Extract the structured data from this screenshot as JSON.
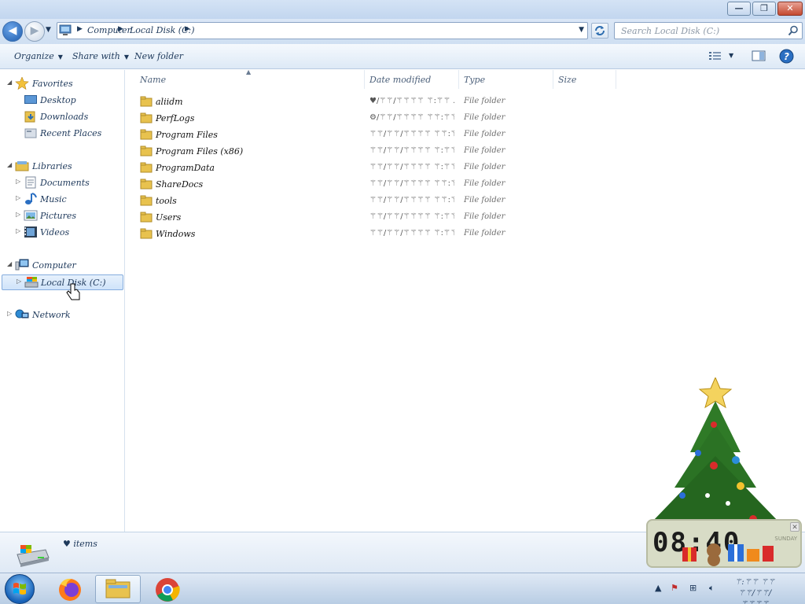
{
  "window": {
    "min_glyph": "—",
    "max_glyph": "❐",
    "close_glyph": "✕"
  },
  "address_bar": {
    "breadcrumbs": [
      "Computer",
      "Local Disk (C:)"
    ],
    "search_placeholder": "Search Local Disk (C:)"
  },
  "toolbar": {
    "organize_label": "Organize",
    "share_label": "Share with",
    "new_folder_label": "New folder"
  },
  "navigation": {
    "favorites_label": "Favorites",
    "favorites": [
      "Desktop",
      "Downloads",
      "Recent Places"
    ],
    "libraries_label": "Libraries",
    "libraries": [
      "Documents",
      "Music",
      "Pictures",
      "Videos"
    ],
    "computer_label": "Computer",
    "selected_drive": "Local Disk (C:)",
    "network_label": "Network"
  },
  "columns": {
    "name": "Name",
    "date": "Date modified",
    "type": "Type",
    "size": "Size"
  },
  "files": [
    {
      "name": "aliidm",
      "date": "♥/⚚⚚/⚚⚚⚚⚚ ⚚:⚚⚚ ...",
      "type": "File folder"
    },
    {
      "name": "PerfLogs",
      "date": "⚙/⚚⚚/⚚⚚⚚⚚ ⚚⚚:⚚⚚ ...",
      "type": "File folder"
    },
    {
      "name": "Program Files",
      "date": "⚚⚚/⚚⚚/⚚⚚⚚⚚ ⚚⚚:⚚⚚ ...",
      "type": "File folder"
    },
    {
      "name": "Program Files (x86)",
      "date": "⚚⚚/⚚⚚/⚚⚚⚚⚚ ⚚:⚚⚚ ...",
      "type": "File folder"
    },
    {
      "name": "ProgramData",
      "date": "⚚⚚/⚚⚚/⚚⚚⚚⚚ ⚚:⚚⚚ ...",
      "type": "File folder"
    },
    {
      "name": "ShareDocs",
      "date": "⚚⚚/⚚⚚/⚚⚚⚚⚚ ⚚⚚:⚚⚚ ...",
      "type": "File folder"
    },
    {
      "name": "tools",
      "date": "⚚⚚/⚚⚚/⚚⚚⚚⚚ ⚚⚚:⚚⚚ ...",
      "type": "File folder"
    },
    {
      "name": "Users",
      "date": "⚚⚚/⚚⚚/⚚⚚⚚⚚ ⚚:⚚⚚ ...",
      "type": "File folder"
    },
    {
      "name": "Windows",
      "date": "⚚⚚/⚚⚚/⚚⚚⚚⚚ ⚚:⚚⚚ ...",
      "type": "File folder"
    }
  ],
  "details": {
    "item_count": "♥ items"
  },
  "taskbar": {
    "clock_time": "⚚:⚚⚚ ⚚⚚",
    "clock_date": "⚚⚚/⚚⚚/⚚⚚⚚⚚"
  },
  "gadget": {
    "digits": "08:40",
    "side_text": "SUNDAY"
  },
  "colors": {
    "selection_bg": "#cfe3fa",
    "folder_yellow": "#e8c24e",
    "tree_green": "#2f7a27"
  }
}
